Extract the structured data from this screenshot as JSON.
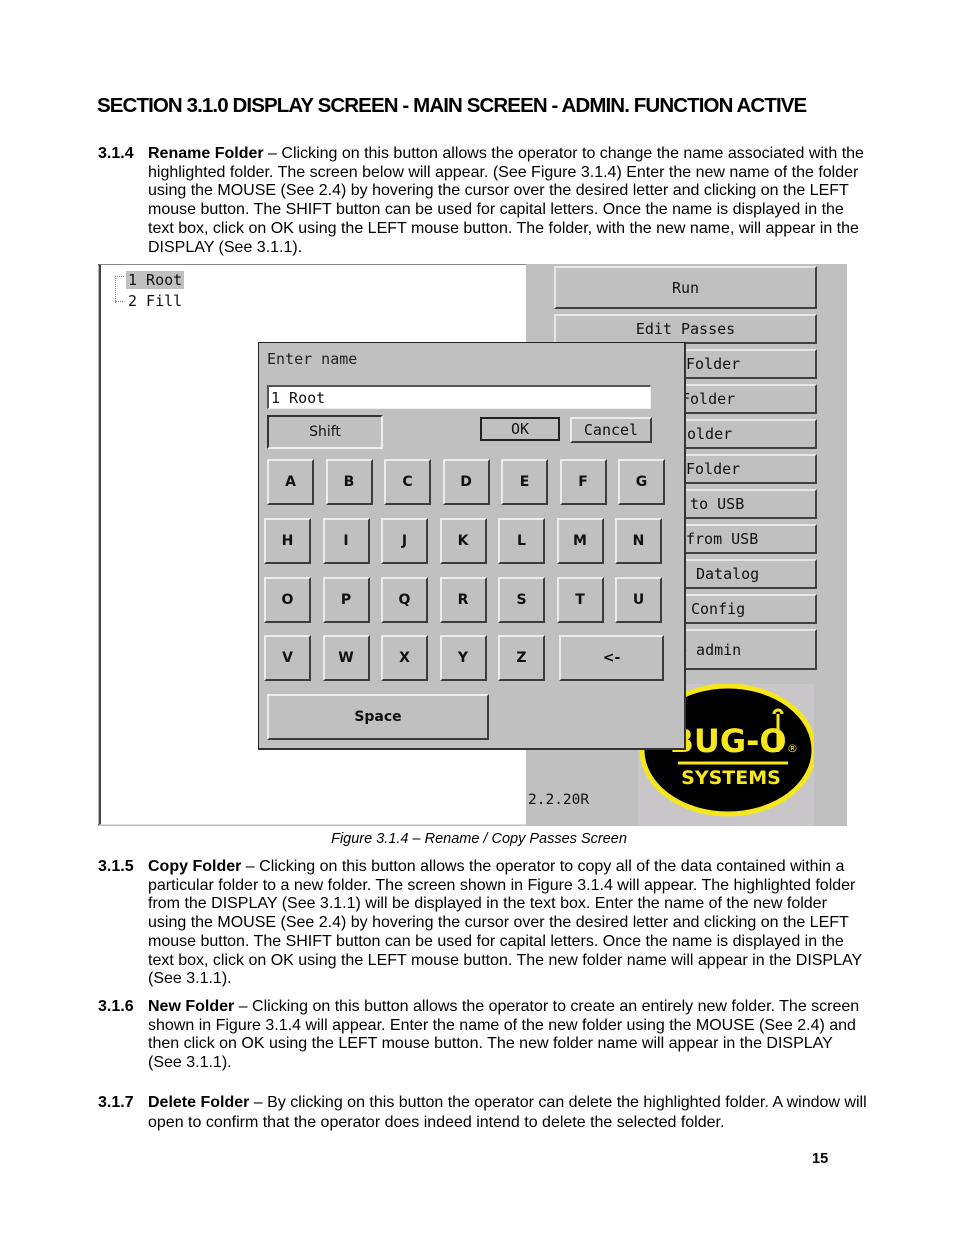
{
  "section_title": "SECTION 3.1.0 DISPLAY SCREEN - MAIN SCREEN - ADMIN. FUNCTION ACTIVE",
  "paragraphs": {
    "p314": {
      "number": "3.1.4",
      "term": "Rename Folder",
      "text": " – Clicking on this button allows the operator to change the name associated with the highlighted folder.  The screen below will appear. (See Figure 3.1.4)  Enter the new name of the folder using the MOUSE (See 2.4) by hovering the cursor over the desired letter and clicking on the LEFT mouse button. The SHIFT button can be used for capital letters. Once the name is displayed in the text box, click on OK using the LEFT mouse button. The folder, with the new name, will appear in the DISPLAY (See 3.1.1)."
    },
    "p315": {
      "number": "3.1.5",
      "term": "Copy Folder",
      "text": " – Clicking on this button allows the operator to copy all of the data contained within a particular folder to a new folder.  The screen shown in Figure 3.1.4 will appear. The highlighted folder from the DISPLAY (See 3.1.1) will be displayed in the text box. Enter the name of the new folder using the MOUSE (See 2.4) by hovering the cursor over the desired letter and clicking on the LEFT mouse button. The SHIFT button can be used for capital letters. Once the name is displayed in the text box, click on OK using the LEFT mouse button. The new folder name will appear in the DISPLAY (See 3.1.1)."
    },
    "p316": {
      "number": "3.1.6",
      "term": "New Folder",
      "text": " – Clicking on this button allows the operator to create an entirely new folder. The screen shown in Figure 3.1.4 will appear. Enter the name of the new folder using the MOUSE (See 2.4) and then click on OK using the LEFT mouse button. The new folder name will appear in the DISPLAY (See 3.1.1)."
    },
    "p317": {
      "number": "3.1.7",
      "term": "Delete Folder",
      "text": " – By clicking on this button the operator can delete the highlighted folder. A window will open to confirm that the operator does indeed intend to delete the selected folder."
    }
  },
  "figure": {
    "caption": "Figure 3.1.4 – Rename / Copy Passes Screen",
    "tree": [
      {
        "label": "1 Root",
        "selected": true
      },
      {
        "label": "2 Fill",
        "selected": false
      }
    ],
    "side_buttons": [
      "Run",
      "Edit Passes",
      "Folder",
      "Folder",
      "older",
      "Folder",
      "r to USB",
      "from USB",
      "Datalog",
      "Config",
      "e admin"
    ],
    "version": "2.2.20R",
    "logo": {
      "main": "BUG-O",
      "sub": "SYSTEMS",
      "mark": "®",
      "colors": {
        "yellow": "#f5e61e",
        "black": "#000000"
      }
    },
    "dialog": {
      "title": "Enter name",
      "input_value": "1 Root",
      "shift_label": "Shift",
      "ok_label": "OK",
      "cancel_label": "Cancel",
      "key_rows": [
        [
          "A",
          "B",
          "C",
          "D",
          "E",
          "F",
          "G"
        ],
        [
          "H",
          "I",
          "J",
          "K",
          "L",
          "M",
          "N"
        ],
        [
          "O",
          "P",
          "Q",
          "R",
          "S",
          "T",
          "U"
        ],
        [
          "V",
          "W",
          "X",
          "Y",
          "Z"
        ]
      ],
      "backspace_label": "<-",
      "space_label": "Space"
    }
  },
  "page_number": "15"
}
